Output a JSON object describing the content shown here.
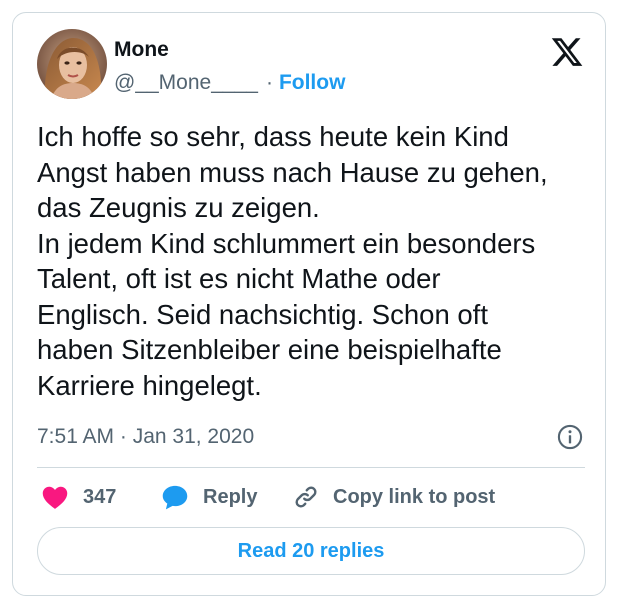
{
  "author": {
    "display_name": "Mone",
    "handle": "@__Mone____",
    "separator": "·",
    "follow_label": "Follow",
    "avatar": "profile-photo"
  },
  "brand": {
    "logo_icon": "x-logo-icon"
  },
  "tweet": {
    "text": "Ich hoffe so sehr, dass heute kein Kind\nAngst haben muss nach Hause zu gehen,\ndas Zeugnis zu zeigen.\nIn jedem Kind schlummert ein besonders\nTalent, oft ist es nicht Mathe oder\nEnglisch. Seid nachsichtig. Schon oft\nhaben Sitzenbleiber eine beispielhafte\nKarriere hingelegt.",
    "timestamp": "7:51 AM · Jan 31, 2020",
    "info_icon": "info-icon"
  },
  "actions": {
    "like_count": "347",
    "like_icon": "heart-icon",
    "reply_label": "Reply",
    "reply_icon": "speech-bubble-icon",
    "copy_label": "Copy link to post",
    "copy_icon": "link-icon"
  },
  "footer": {
    "read_replies_label": "Read 20 replies"
  },
  "colors": {
    "accent": "#1d9bf0",
    "like": "#f91880",
    "text": "#0f1419",
    "muted": "#536471",
    "border": "#cfd9de"
  }
}
